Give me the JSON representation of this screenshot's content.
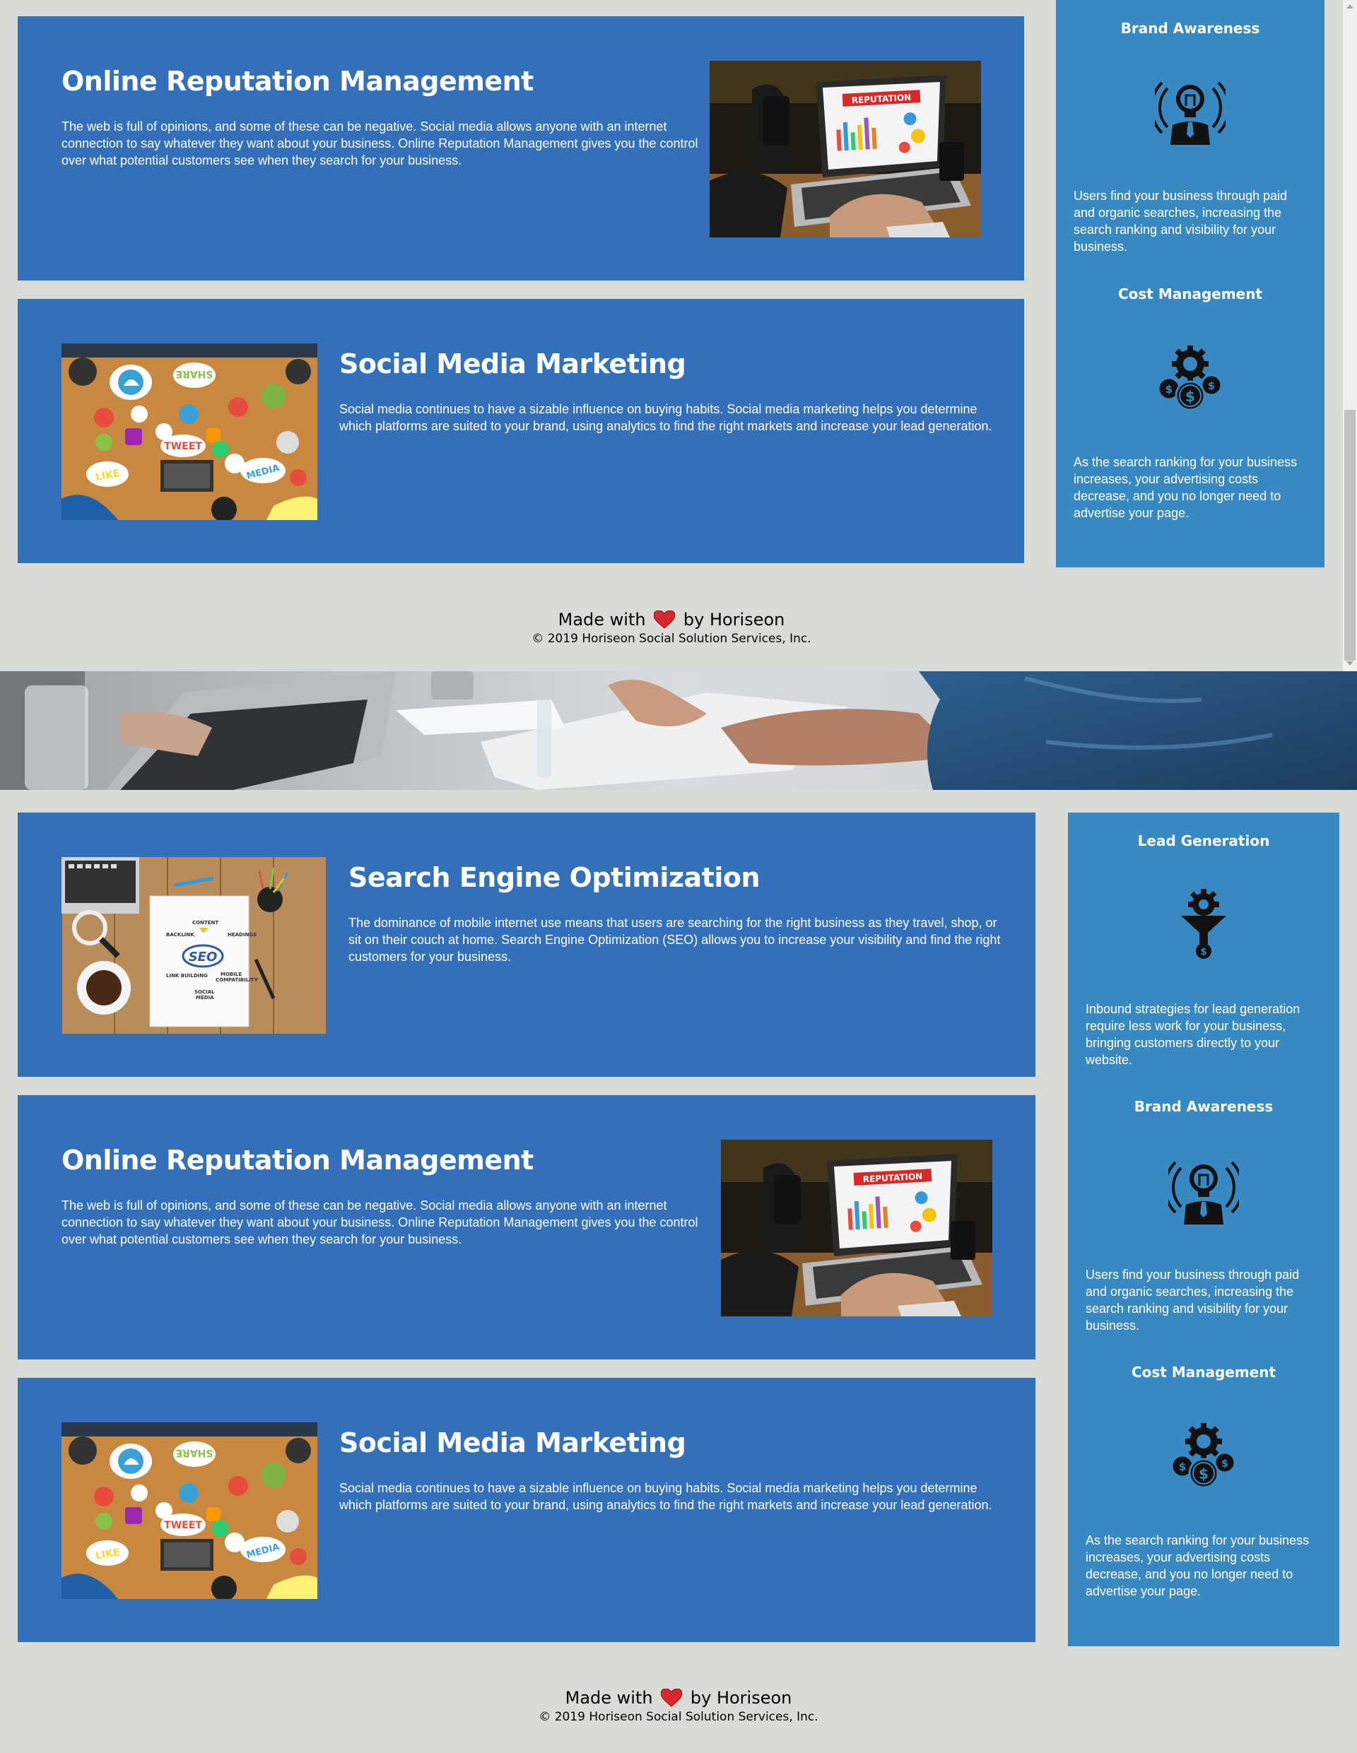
{
  "colors": {
    "page_background": "#d9dcd6",
    "card_background": "#3370b9",
    "aside_background": "#3889c1",
    "heart": "#d9272e"
  },
  "section1": {
    "reputation": {
      "title": "Online Reputation Management",
      "body": "The web is full of opinions, and some of these can be negative. Social media allows anyone with an internet connection to say whatever they want about your business. Online Reputation Management gives you the control over what potential customers see when they search for your business.",
      "image_text": "REPUTATION"
    },
    "social": {
      "title": "Social Media Marketing",
      "body": "Social media continues to have a sizable influence on buying habits. Social media marketing helps you determine which platforms are suited to your brand, using analytics to find the right markets and increase your lead generation.",
      "image_words": [
        "SHARE",
        "TWEET",
        "LIKE",
        "MEDIA"
      ]
    },
    "aside": {
      "brand": {
        "title": "Brand Awareness",
        "icon": "lightbulb-person-icon",
        "body": "Users find your business through paid and organic searches, increasing the search ranking and visibility for your business."
      },
      "cost": {
        "title": "Cost Management",
        "icon": "gear-coins-icon",
        "body": "As the search ranking for your business increases, your advertising costs decrease, and you no longer need to advertise your page."
      }
    },
    "footer": {
      "made_prefix": "Made with",
      "made_suffix": "by Horiseon",
      "copyright": "© 2019 Horiseon Social Solution Services, Inc."
    }
  },
  "section2": {
    "seo": {
      "title": "Search Engine Optimization",
      "body": "The dominance of mobile internet use means that users are searching for the right business as they travel, shop, or sit on their couch at home. Search Engine Optimization (SEO) allows you to increase your visibility and find the right customers for your business.",
      "image_words": [
        "SEO",
        "CONTENT",
        "BACKLINK",
        "HEADINGS",
        "LINK BUILDING",
        "MOBILE COMPATIBILITY",
        "SOCIAL MEDIA"
      ]
    },
    "reputation": {
      "title": "Online Reputation Management",
      "body": "The web is full of opinions, and some of these can be negative. Social media allows anyone with an internet connection to say whatever they want about your business. Online Reputation Management gives you the control over what potential customers see when they search for your business.",
      "image_text": "REPUTATION"
    },
    "social": {
      "title": "Social Media Marketing",
      "body": "Social media continues to have a sizable influence on buying habits. Social media marketing helps you determine which platforms are suited to your brand, using analytics to find the right markets and increase your lead generation.",
      "image_words": [
        "SHARE",
        "TWEET",
        "LIKE",
        "MEDIA"
      ]
    },
    "aside": {
      "lead": {
        "title": "Lead Generation",
        "icon": "funnel-gear-icon",
        "body": "Inbound strategies for lead generation require less work for your business, bringing customers directly to your website."
      },
      "brand": {
        "title": "Brand Awareness",
        "icon": "lightbulb-person-icon",
        "body": "Users find your business through paid and organic searches, increasing the search ranking and visibility for your business."
      },
      "cost": {
        "title": "Cost Management",
        "icon": "gear-coins-icon",
        "body": "As the search ranking for your business increases, your advertising costs decrease, and you no longer need to advertise your page."
      }
    },
    "footer": {
      "made_prefix": "Made with",
      "made_suffix": "by Horiseon",
      "copyright": "© 2019 Horiseon Social Solution Services, Inc."
    }
  }
}
